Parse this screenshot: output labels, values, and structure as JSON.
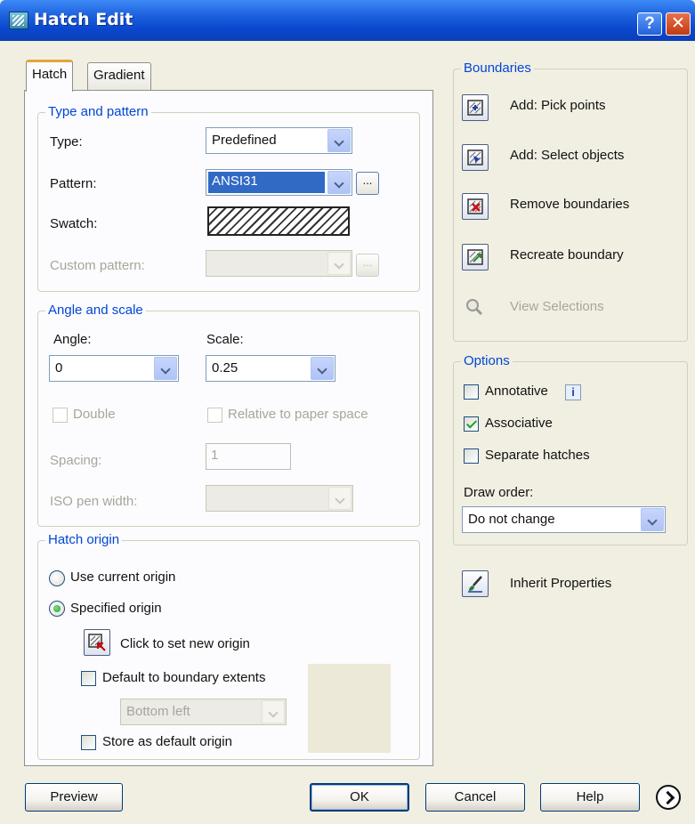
{
  "window": {
    "title": "Hatch Edit",
    "help_glyph": "?",
    "close_glyph": "✕"
  },
  "tabs": [
    {
      "label": "Hatch",
      "active": true
    },
    {
      "label": "Gradient",
      "active": false
    }
  ],
  "type_pattern": {
    "legend": "Type and pattern",
    "type_label": "Type:",
    "type_value": "Predefined",
    "pattern_label": "Pattern:",
    "pattern_value": "ANSI31",
    "ellipsis": "...",
    "swatch_label": "Swatch:",
    "custom_label": "Custom pattern:",
    "custom_value": ""
  },
  "angle_scale": {
    "legend": "Angle and scale",
    "angle_label": "Angle:",
    "angle_value": "0",
    "scale_label": "Scale:",
    "scale_value": "0.25",
    "double_label": "Double",
    "relative_label": "Relative to paper space",
    "spacing_label": "Spacing:",
    "spacing_value": "1",
    "iso_label": "ISO pen width:",
    "iso_value": ""
  },
  "hatch_origin": {
    "legend": "Hatch origin",
    "use_current": "Use current origin",
    "specified": "Specified origin",
    "click_set": "Click to set new origin",
    "default_extents": "Default to boundary extents",
    "position_value": "Bottom left",
    "store_default": "Store as default origin"
  },
  "boundaries": {
    "legend": "Boundaries",
    "add_pick": "Add: Pick points",
    "add_select": "Add: Select objects",
    "remove": "Remove boundaries",
    "recreate": "Recreate boundary",
    "view": "View Selections"
  },
  "options": {
    "legend": "Options",
    "annotative": "Annotative",
    "annotative_checked": false,
    "info_glyph": "i",
    "associative": "Associative",
    "associative_checked": true,
    "separate": "Separate hatches",
    "separate_checked": false,
    "draw_order_label": "Draw order:",
    "draw_order_value": "Do not change"
  },
  "inherit": "Inherit Properties",
  "buttons": {
    "preview": "Preview",
    "ok": "OK",
    "cancel": "Cancel",
    "help": "Help"
  },
  "colors": {
    "titlebar": "#0a48cf",
    "legend": "#0046d5",
    "selection": "#316ac5",
    "dialog_bg": "#f1efe2"
  }
}
